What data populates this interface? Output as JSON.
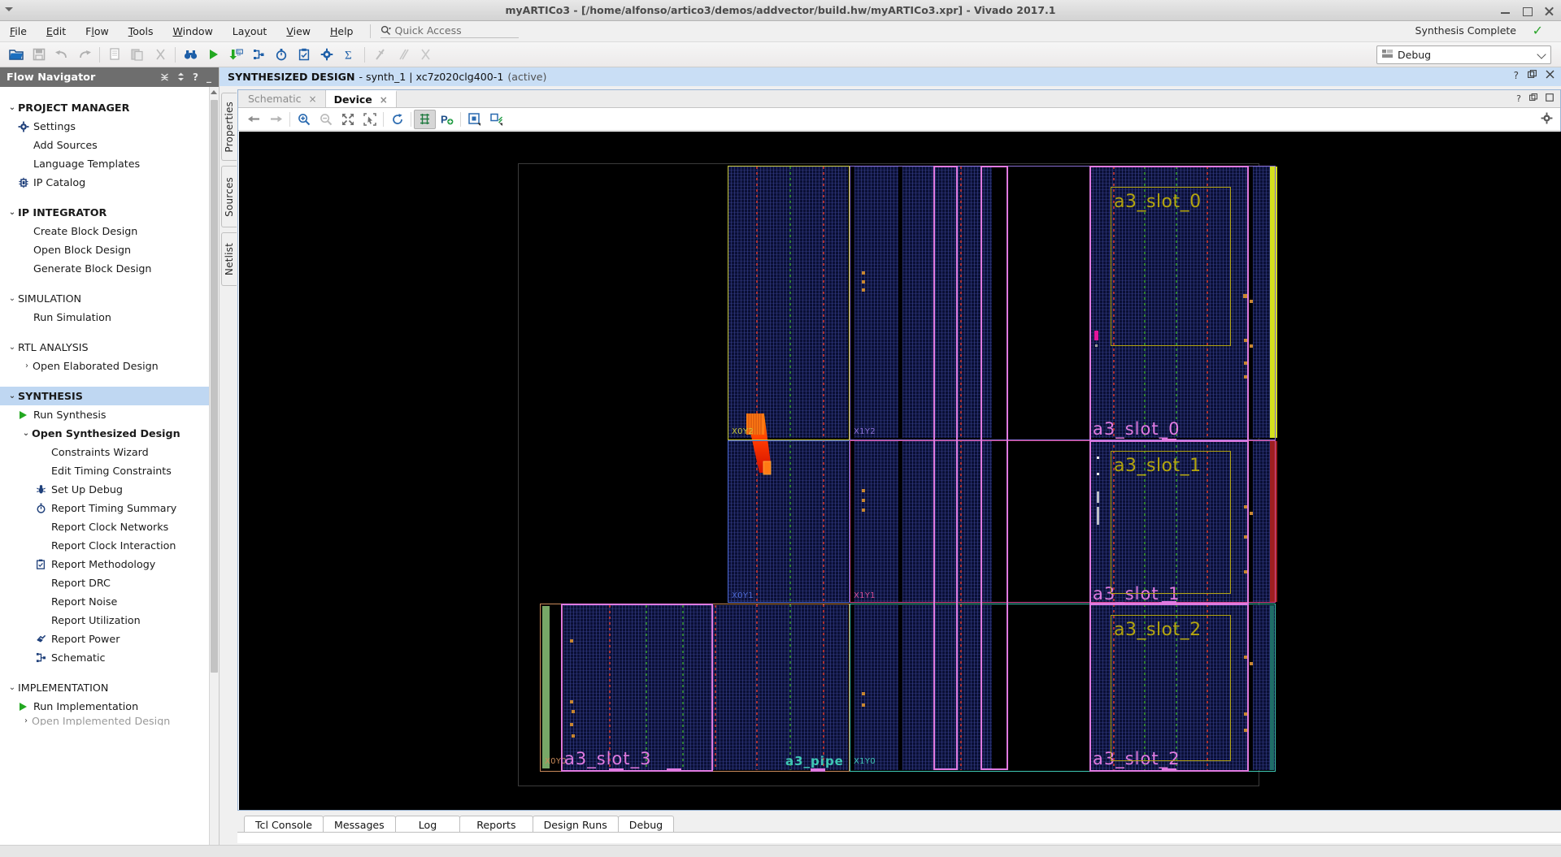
{
  "window": {
    "title": "myARTICo3 - [/home/alfonso/artico3/demos/addvector/build.hw/myARTICo3.xpr] - Vivado 2017.1",
    "minimize": "–",
    "maximize": "□",
    "close": "×"
  },
  "menubar": {
    "items": [
      {
        "label": "File",
        "accel": "F"
      },
      {
        "label": "Edit",
        "accel": "E"
      },
      {
        "label": "Flow",
        "accel": "l"
      },
      {
        "label": "Tools",
        "accel": "T"
      },
      {
        "label": "Window",
        "accel": "W"
      },
      {
        "label": "Layout",
        "accel": "y"
      },
      {
        "label": "View",
        "accel": "V"
      },
      {
        "label": "Help",
        "accel": "H"
      }
    ],
    "quick_access_placeholder": "Quick Access",
    "quick_access_value": "",
    "status_right": "Synthesis Complete",
    "status_check": "✓"
  },
  "toolbar": {
    "buttons": [
      {
        "name": "open-project-icon",
        "glyph": "folder",
        "enabled": true
      },
      {
        "name": "save-icon",
        "glyph": "save",
        "enabled": false
      },
      {
        "name": "undo-icon",
        "glyph": "undo",
        "enabled": false
      },
      {
        "name": "redo-icon",
        "glyph": "redo",
        "enabled": false
      },
      {
        "name": "copy-icon",
        "glyph": "copy",
        "enabled": false
      },
      {
        "name": "paste-icon",
        "glyph": "paste",
        "enabled": false
      },
      {
        "name": "cut-icon",
        "glyph": "cut",
        "enabled": false
      },
      {
        "name": "search-icon",
        "glyph": "binocular",
        "enabled": true
      },
      {
        "name": "run-icon",
        "glyph": "play",
        "enabled": true
      },
      {
        "name": "write-bitstream-icon",
        "glyph": "bits",
        "enabled": true
      },
      {
        "name": "schematic-icon",
        "glyph": "schem",
        "enabled": true
      },
      {
        "name": "timing-icon",
        "glyph": "clock",
        "enabled": true
      },
      {
        "name": "methodology-icon",
        "glyph": "clipboard",
        "enabled": true
      },
      {
        "name": "settings-icon",
        "glyph": "gear",
        "enabled": true
      },
      {
        "name": "sigma-icon",
        "glyph": "sigma",
        "enabled": true
      },
      {
        "name": "mark-icon",
        "glyph": "slash1",
        "enabled": false
      },
      {
        "name": "unmark-icon",
        "glyph": "slash2",
        "enabled": false
      },
      {
        "name": "clear-icon",
        "glyph": "xmark",
        "enabled": false
      }
    ],
    "layout_select": {
      "label": "Debug",
      "icon": "layout-icon",
      "chevron": "⌄"
    }
  },
  "flow_navigator": {
    "title": "Flow Navigator",
    "header_icons": [
      "collapse-all-icon",
      "expand-icon",
      "help-icon",
      "minimize-icon"
    ],
    "sections": [
      {
        "label": "PROJECT MANAGER",
        "chev": "⌄",
        "bold": true,
        "selected": false,
        "items": [
          {
            "label": "Settings",
            "icon": "gear-icon"
          },
          {
            "label": "Add Sources",
            "icon": ""
          },
          {
            "label": "Language Templates",
            "icon": ""
          },
          {
            "label": "IP Catalog",
            "icon": "ip-catalog-icon"
          }
        ]
      },
      {
        "label": "IP INTEGRATOR",
        "chev": "⌄",
        "bold": true,
        "selected": false,
        "items": [
          {
            "label": "Create Block Design",
            "icon": ""
          },
          {
            "label": "Open Block Design",
            "icon": ""
          },
          {
            "label": "Generate Block Design",
            "icon": ""
          }
        ]
      },
      {
        "label": "SIMULATION",
        "chev": "⌄",
        "bold": false,
        "selected": false,
        "items": [
          {
            "label": "Run Simulation",
            "icon": ""
          }
        ]
      },
      {
        "label": "RTL ANALYSIS",
        "chev": "⌄",
        "bold": false,
        "selected": false,
        "items": [
          {
            "label": "Open Elaborated Design",
            "icon": "",
            "chev": "›"
          }
        ]
      },
      {
        "label": "SYNTHESIS",
        "chev": "⌄",
        "bold": true,
        "selected": true,
        "items": [
          {
            "label": "Run Synthesis",
            "icon": "play-icon"
          },
          {
            "label": "Open Synthesized Design",
            "icon": "",
            "chev": "⌄",
            "bold": true
          },
          {
            "label": "Constraints Wizard",
            "icon": "",
            "indent": 2
          },
          {
            "label": "Edit Timing Constraints",
            "icon": "",
            "indent": 2
          },
          {
            "label": "Set Up Debug",
            "icon": "bug-icon",
            "indent": 2
          },
          {
            "label": "Report Timing Summary",
            "icon": "clock-icon",
            "indent": 2
          },
          {
            "label": "Report Clock Networks",
            "icon": "",
            "indent": 2
          },
          {
            "label": "Report Clock Interaction",
            "icon": "",
            "indent": 2
          },
          {
            "label": "Report Methodology",
            "icon": "clipboard-icon",
            "indent": 2
          },
          {
            "label": "Report DRC",
            "icon": "",
            "indent": 2
          },
          {
            "label": "Report Noise",
            "icon": "",
            "indent": 2
          },
          {
            "label": "Report Utilization",
            "icon": "",
            "indent": 2
          },
          {
            "label": "Report Power",
            "icon": "power-icon",
            "indent": 2
          },
          {
            "label": "Schematic",
            "icon": "schematic-icon",
            "indent": 2
          }
        ]
      },
      {
        "label": "IMPLEMENTATION",
        "chev": "⌄",
        "bold": false,
        "selected": false,
        "items": [
          {
            "label": "Run Implementation",
            "icon": "play-icon"
          },
          {
            "label": "Open Implemented Design",
            "icon": "",
            "chev": "›",
            "clipped": true
          }
        ]
      }
    ]
  },
  "design_header": {
    "title": "SYNTHESIZED DESIGN",
    "subtitle": "- synth_1 | xc7z020clg400-1",
    "state": "(active)",
    "icons": [
      "help-icon",
      "float-icon",
      "maximize-icon",
      "close-icon"
    ]
  },
  "vertical_tabs": [
    {
      "label": "Properties"
    },
    {
      "label": "Sources"
    },
    {
      "label": "Netlist"
    }
  ],
  "panel": {
    "tabs": [
      {
        "label": "Schematic",
        "active": false,
        "close": "×"
      },
      {
        "label": "Device",
        "active": true,
        "close": "×"
      }
    ],
    "header_icons": [
      "help-icon",
      "float-icon",
      "maximize-icon"
    ],
    "toolbar": [
      {
        "name": "back-arrow-icon",
        "glyph": "left",
        "enabled": true
      },
      {
        "name": "forward-arrow-icon",
        "glyph": "right",
        "enabled": false
      },
      {
        "name": "zoom-in-icon",
        "glyph": "zin",
        "enabled": true
      },
      {
        "name": "zoom-out-icon",
        "glyph": "zout",
        "enabled": false
      },
      {
        "name": "zoom-fit-icon",
        "glyph": "fit",
        "enabled": true
      },
      {
        "name": "zoom-area-icon",
        "glyph": "area",
        "enabled": true
      },
      {
        "name": "refresh-icon",
        "glyph": "refresh",
        "enabled": true
      },
      {
        "name": "routing-resources-icon",
        "glyph": "grid",
        "enabled": true,
        "toggled": true
      },
      {
        "name": "add-pblock-icon",
        "glyph": "padd",
        "enabled": true
      },
      {
        "name": "highlight-region-icon",
        "glyph": "sq",
        "enabled": true
      },
      {
        "name": "select-region-icon",
        "glyph": "sel",
        "enabled": true
      }
    ],
    "settings_icon": "gear-icon"
  },
  "device_view": {
    "part": "xc7z020clg400-1",
    "clock_regions": [
      {
        "label": "X0Y2",
        "color": "#c9c83a"
      },
      {
        "label": "X1Y2",
        "color": "#8a6fd4"
      },
      {
        "label": "X0Y1",
        "color": "#4f6bd6"
      },
      {
        "label": "X1Y1",
        "color": "#d44d94"
      },
      {
        "label": "X0Y0",
        "color": "#c98a5a"
      },
      {
        "label": "X1Y0",
        "color": "#3aaf9b"
      }
    ],
    "pblocks": [
      {
        "label": "a3_slot_0",
        "color": "#e07ae0"
      },
      {
        "label": "a3_slot_1",
        "color": "#e07ae0"
      },
      {
        "label": "a3_slot_2",
        "color": "#e07ae0"
      },
      {
        "label": "a3_slot_3",
        "color": "#e07ae0"
      },
      {
        "label": "a3_pipe",
        "color": "#3ec8b4"
      }
    ],
    "cells": [
      {
        "label": "a3_slot_0",
        "color": "#b3a40e"
      },
      {
        "label": "a3_slot_1",
        "color": "#b3a40e"
      },
      {
        "label": "a3_slot_2",
        "color": "#b3a40e"
      }
    ],
    "colors": {
      "background": "#000000",
      "fabric": "#0a0f35",
      "pblock_outline": "#e07ae0",
      "cell_outline": "#b3a40e",
      "net_highlight": "#ff2a00",
      "io_bank_green": "#9fe08a",
      "io_bank_yellow": "#d4e01e",
      "io_bank_red": "#b02020"
    }
  },
  "bottom_tabs": [
    {
      "label": "Tcl Console"
    },
    {
      "label": "Messages"
    },
    {
      "label": "Log"
    },
    {
      "label": "Reports"
    },
    {
      "label": "Design Runs"
    },
    {
      "label": "Debug"
    }
  ]
}
